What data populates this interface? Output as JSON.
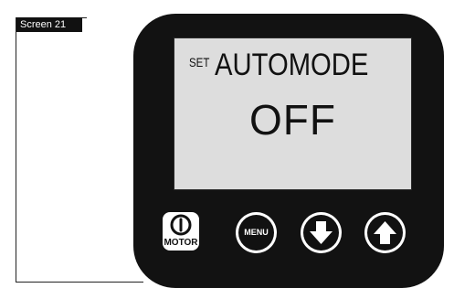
{
  "header": {
    "screen_label": "Screen 21"
  },
  "display": {
    "prefix": "SET",
    "title": "AUTOMODE",
    "value": "OFF"
  },
  "buttons": {
    "motor_label": "MOTOR",
    "menu_label": "MENU",
    "down_icon": "arrow-down-icon",
    "up_icon": "arrow-up-icon",
    "power_icon": "power-icon"
  },
  "colors": {
    "device_body": "#121212",
    "lcd_background": "#dddddd",
    "button_face": "#ffffff"
  }
}
